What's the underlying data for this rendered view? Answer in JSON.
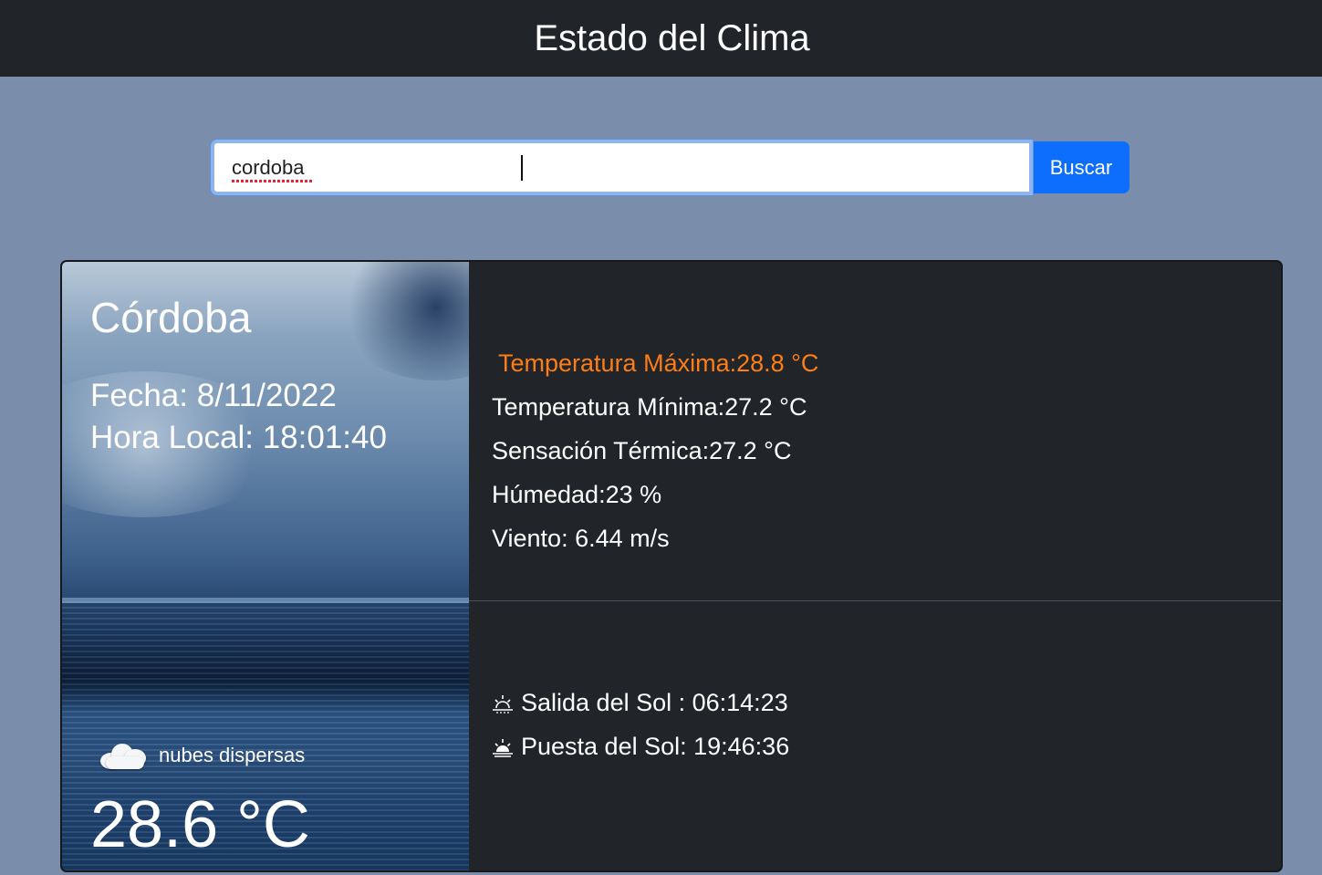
{
  "header": {
    "title": "Estado del Clima"
  },
  "search": {
    "value": "cordoba",
    "button_label": "Buscar"
  },
  "weather": {
    "city": "Córdoba",
    "date_line": "Fecha: 8/11/2022",
    "time_line": "Hora Local: 18:01:40",
    "description": "nubes dispersas",
    "description_icon": "scattered-clouds-icon",
    "temperature": "28.6 °C",
    "max_temp": "Temperatura Máxima:28.8 °C",
    "min_temp": "Temperatura Mínima:27.2 °C",
    "feels_like": "Sensación Térmica:27.2 °C",
    "humidity": "Húmedad:23 %",
    "wind": "Viento: 6.44 m/s",
    "sunrise": "Salida del Sol : 06:14:23",
    "sunset": "Puesta del Sol: 19:46:36",
    "sunrise_icon": "sunrise-icon",
    "sunset_icon": "sunset-icon"
  },
  "colors": {
    "header_bg": "#212429",
    "page_bg": "#7a8eab",
    "card_bg": "#212429",
    "button_bg": "#0d6efd",
    "max_temp_accent": "#fd7e14"
  }
}
